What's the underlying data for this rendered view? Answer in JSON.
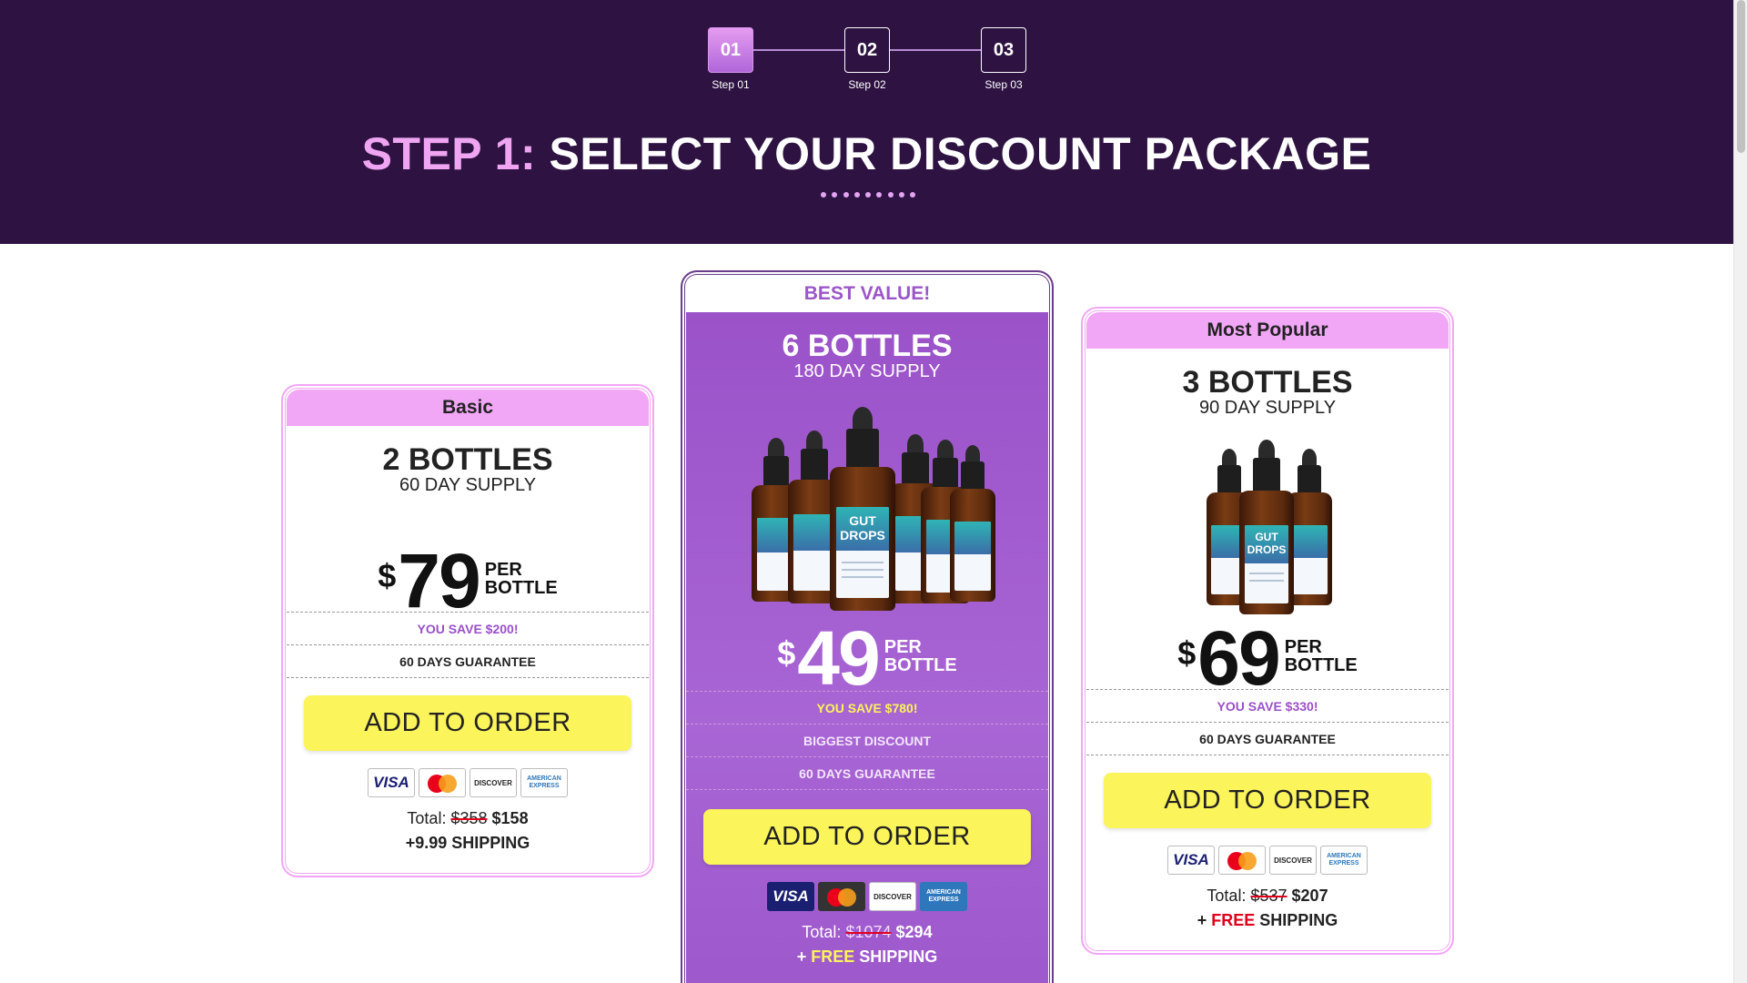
{
  "steps": [
    {
      "number": "01",
      "label": "Step 01",
      "active": true
    },
    {
      "number": "02",
      "label": "Step 02",
      "active": false
    },
    {
      "number": "03",
      "label": "Step 03",
      "active": false
    }
  ],
  "headline": {
    "accent": "STEP 1:",
    "rest": "SELECT YOUR DISCOUNT PACKAGE"
  },
  "colors": {
    "header_bg": "#2e1342",
    "accent_pink": "#f2a6f6",
    "purple": "#9b52c9",
    "button_yellow": "#fbf45a",
    "free_red": "#e0001a"
  },
  "packages": {
    "basic": {
      "header": "Basic",
      "bottles": "2 BOTTLES",
      "supply": "60 DAY SUPPLY",
      "bottle_count_shown": 0,
      "currency": "$",
      "price": "79",
      "per_line1": "PER",
      "per_line2": "BOTTLE",
      "savings": "YOU SAVE $200!",
      "guarantee": "60 DAYS GUARANTEE",
      "button": "ADD TO ORDER",
      "total_label": "Total:",
      "total_old": "$358",
      "total_new": "$158",
      "shipping": "+9.99 SHIPPING"
    },
    "best": {
      "header": "BEST VALUE!",
      "bottles": "6 BOTTLES",
      "supply": "180 DAY SUPPLY",
      "bottle_count_shown": 6,
      "currency": "$",
      "price": "49",
      "per_line1": "PER",
      "per_line2": "BOTTLE",
      "savings": "YOU SAVE $780!",
      "extra": "BIGGEST DISCOUNT",
      "guarantee": "60 DAYS GUARANTEE",
      "button": "ADD TO ORDER",
      "total_label": "Total:",
      "total_old": "$1074",
      "total_new": "$294",
      "shipping_prefix": "+",
      "shipping_free": "FREE",
      "shipping_suffix": "SHIPPING"
    },
    "popular": {
      "header": "Most Popular",
      "bottles": "3 BOTTLES",
      "supply": "90 DAY SUPPLY",
      "bottle_count_shown": 3,
      "currency": "$",
      "price": "69",
      "per_line1": "PER",
      "per_line2": "BOTTLE",
      "savings": "YOU SAVE $330!",
      "guarantee": "60 DAYS GUARANTEE",
      "button": "ADD TO ORDER",
      "total_label": "Total:",
      "total_old": "$537",
      "total_new": "$207",
      "shipping_prefix": "+",
      "shipping_free": "FREE",
      "shipping_suffix": "SHIPPING"
    }
  },
  "product": {
    "label_line1": "GUT",
    "label_line2": "DROPS"
  },
  "payment_cards": [
    {
      "icon": "visa-card-icon",
      "text": "VISA"
    },
    {
      "icon": "mastercard-icon",
      "text": ""
    },
    {
      "icon": "discover-card-icon",
      "text": "DISCOVER"
    },
    {
      "icon": "amex-card-icon",
      "text": "AMERICAN EXPRESS"
    }
  ]
}
